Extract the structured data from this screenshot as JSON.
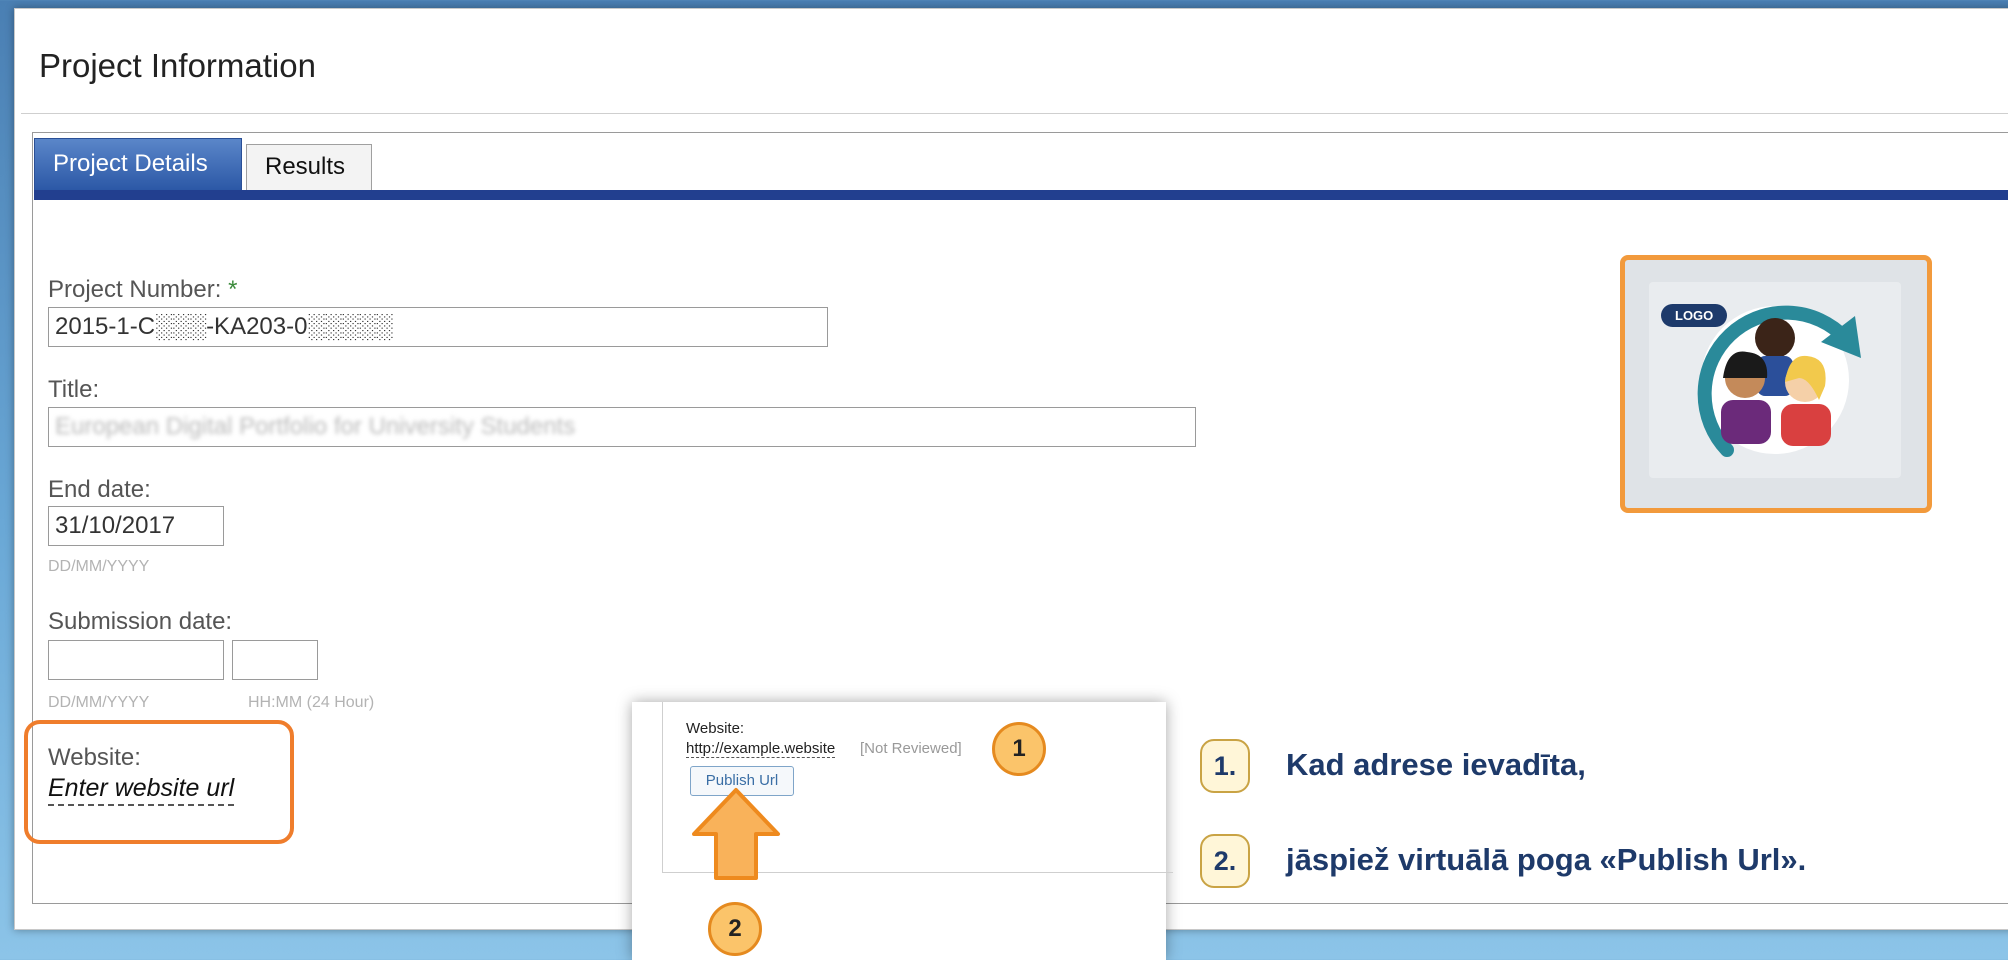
{
  "page_title": "Project Information",
  "tabs": [
    {
      "label": "Project Details",
      "active": true
    },
    {
      "label": "Results",
      "active": false
    }
  ],
  "form": {
    "project_number": {
      "label": "Project Number:",
      "required_mark": "*",
      "value": "2015-1-C░░░-KA203-0░░░░░"
    },
    "title": {
      "label": "Title:",
      "value": "European Digital Portfolio for University Students"
    },
    "end_date": {
      "label": "End date:",
      "value": "31/10/2017",
      "hint": "DD/MM/YYYY"
    },
    "submission_date": {
      "label": "Submission date:",
      "date_value": "",
      "time_value": "",
      "date_hint": "DD/MM/YYYY",
      "time_hint": "HH:MM (24 Hour)"
    },
    "website": {
      "label": "Website:",
      "placeholder": "Enter website url"
    }
  },
  "logo": {
    "badge": "LOGO"
  },
  "inset": {
    "label": "Website:",
    "url": "http://example.website",
    "status": "[Not Reviewed]",
    "button_label": "Publish Url",
    "marker_1": "1",
    "marker_2": "2"
  },
  "steps": [
    {
      "number": "1.",
      "text": "Kad adrese ievadīta,"
    },
    {
      "number": "2.",
      "text": "jāspiež virtuālā poga «Publish Url»."
    }
  ],
  "colors": {
    "tab_active": "#2c58a6",
    "tab_bar": "#223f8f",
    "highlight": "#ef7d2c",
    "marker": "#fbc46a",
    "step_text": "#1e3a6a"
  }
}
